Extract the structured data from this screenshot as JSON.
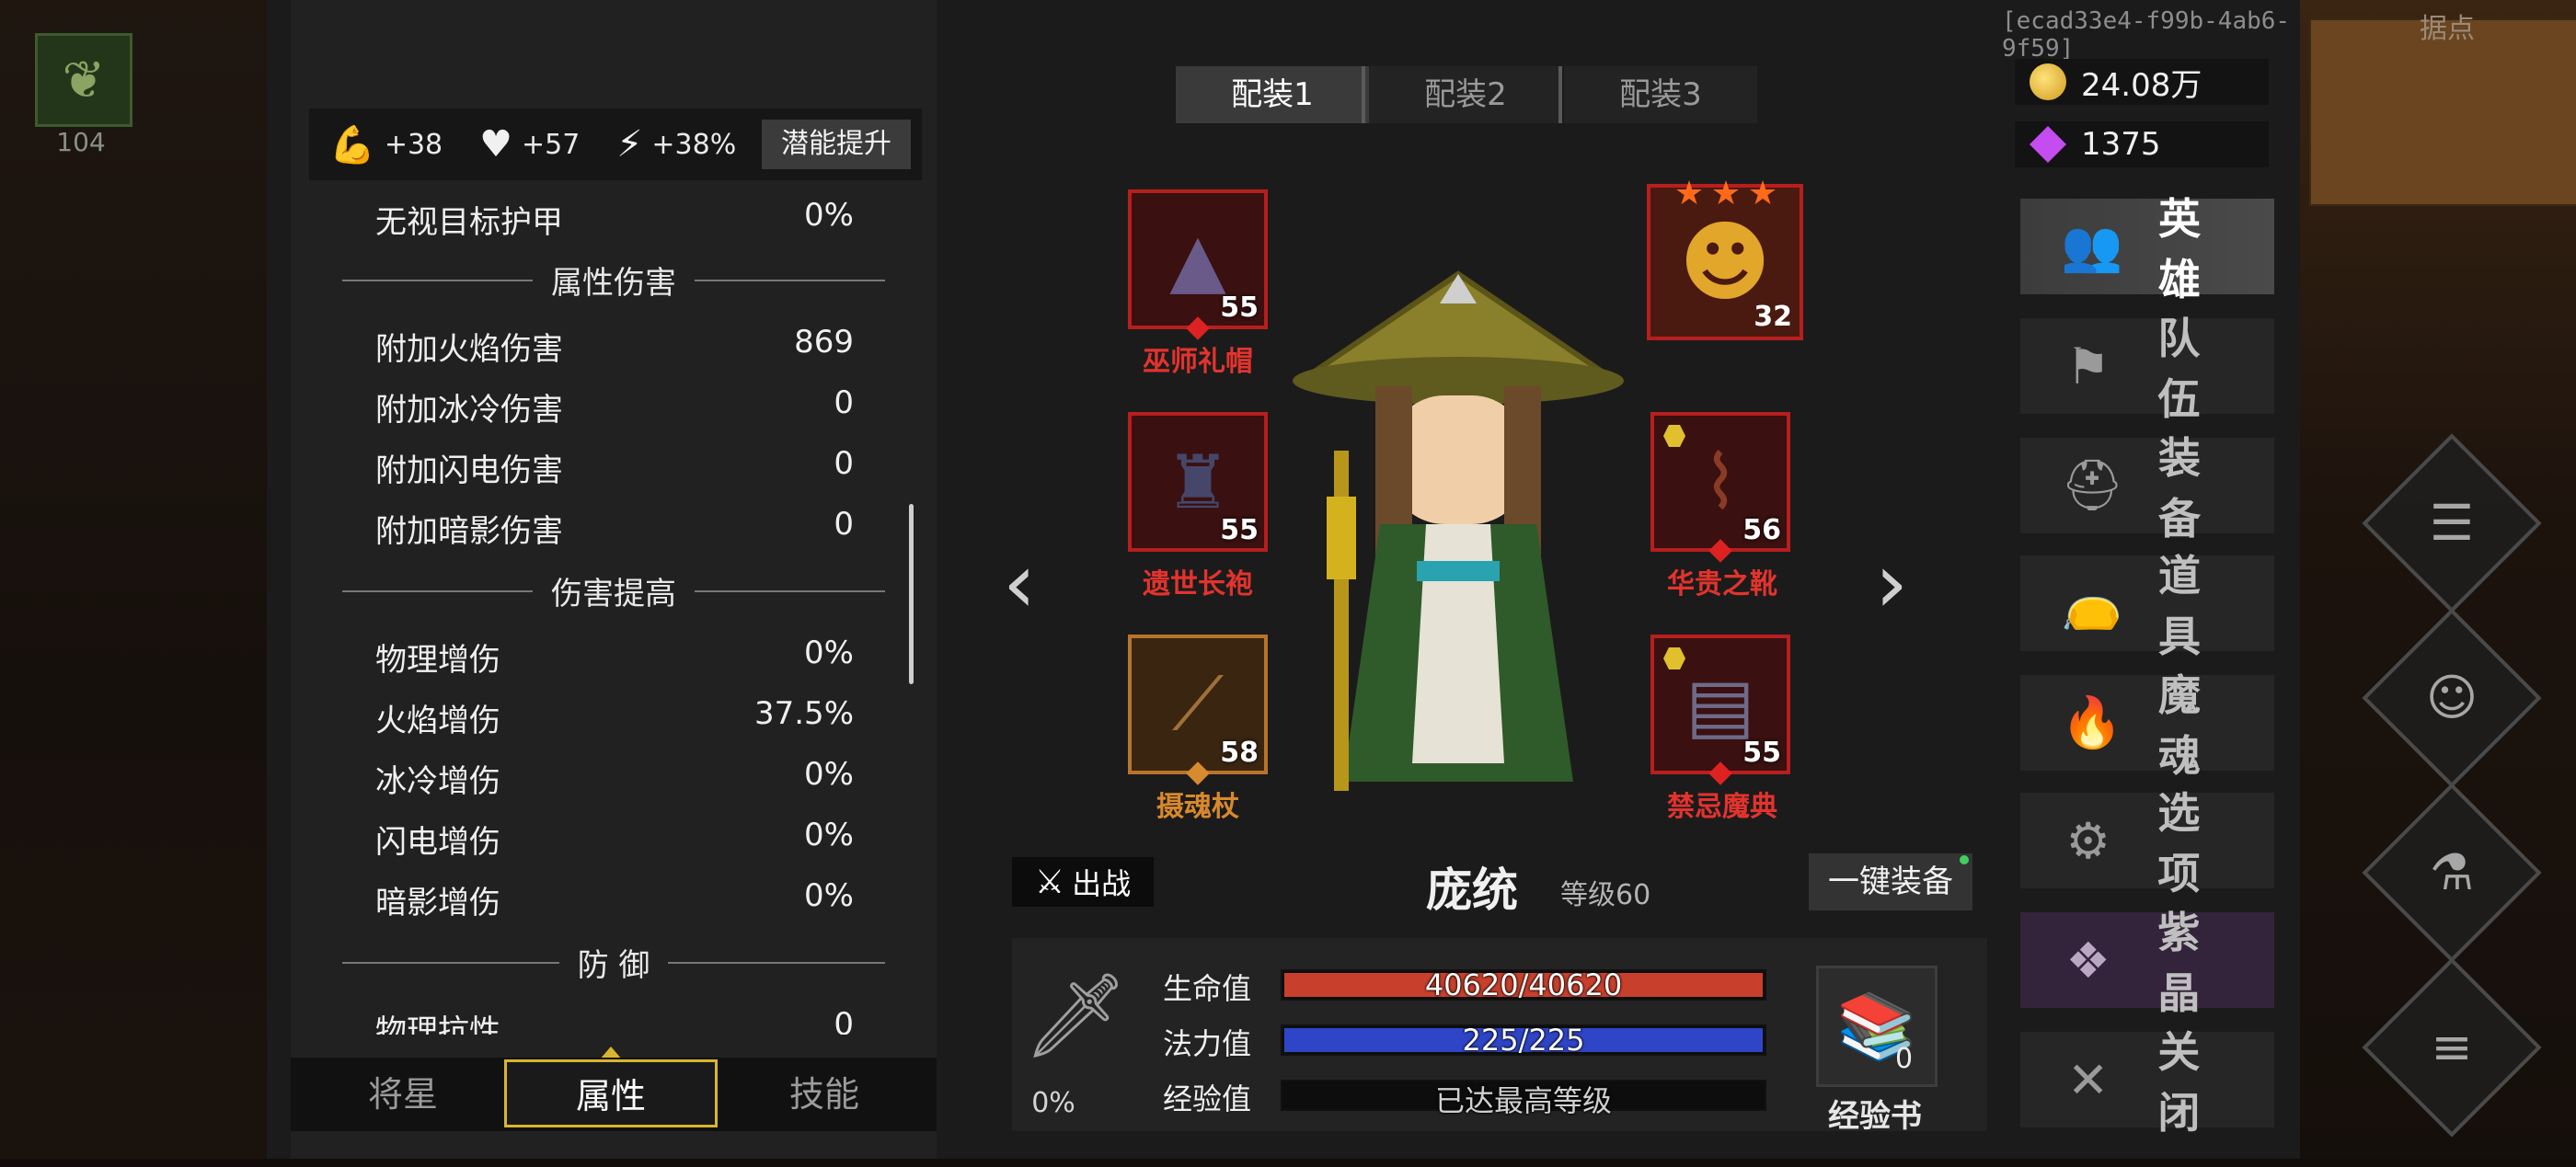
{
  "session_id": "[ecad33e4-f99b-4ab6-9f59]",
  "background": {
    "map_label": "据点",
    "skill_count": "104"
  },
  "stat_bar": {
    "strength": "+38",
    "vitality": "+57",
    "speed": "+38%",
    "potential_button": "潜能提升"
  },
  "attributes": {
    "rows_top": [
      {
        "label": "无视目标护甲",
        "value": "0%"
      }
    ],
    "section_elemental": "属性伤害",
    "elemental": [
      {
        "label": "附加火焰伤害",
        "value": "869"
      },
      {
        "label": "附加冰冷伤害",
        "value": "0"
      },
      {
        "label": "附加闪电伤害",
        "value": "0"
      },
      {
        "label": "附加暗影伤害",
        "value": "0"
      }
    ],
    "section_damage": "伤害提高",
    "damage": [
      {
        "label": "物理增伤",
        "value": "0%"
      },
      {
        "label": "火焰增伤",
        "value": "37.5%"
      },
      {
        "label": "冰冷增伤",
        "value": "0%"
      },
      {
        "label": "闪电增伤",
        "value": "0%"
      },
      {
        "label": "暗影增伤",
        "value": "0%"
      }
    ],
    "section_defense": "防 御",
    "defense": [
      {
        "label": "物理抗性",
        "value": "0"
      }
    ]
  },
  "bottom_tabs": [
    "将星",
    "属性",
    "技能"
  ],
  "loadout_tabs": [
    "配装1",
    "配装2",
    "配装3"
  ],
  "equipment": {
    "hat": {
      "name": "巫师礼帽",
      "level": "55"
    },
    "robe": {
      "name": "遗世长袍",
      "level": "55"
    },
    "staff": {
      "name": "摄魂杖",
      "level": "58"
    },
    "boots": {
      "name": "华贵之靴",
      "level": "56"
    },
    "tome": {
      "name": "禁忌魔典",
      "level": "55"
    },
    "companion": {
      "level": "32",
      "stars": 3
    }
  },
  "hero": {
    "deploy_label": "出战",
    "name": "庞统",
    "level": "等级60",
    "equip_all": "一键装备",
    "hp_label": "生命值",
    "hp_value": "40620/40620",
    "hp_fraction": 1.0,
    "mp_label": "法力值",
    "mp_value": "225/225",
    "mp_fraction": 1.0,
    "exp_label": "经验值",
    "exp_value": "已达最高等级",
    "attack_pct": "0%",
    "exp_book_label": "经验书",
    "exp_book_count": "0"
  },
  "currency": {
    "gold": "24.08万",
    "gems": "1375"
  },
  "menu": [
    {
      "label": "英雄",
      "icon": "hero-icon"
    },
    {
      "label": "队伍",
      "icon": "flag-icon"
    },
    {
      "label": "装备",
      "icon": "helmet-icon"
    },
    {
      "label": "道具",
      "icon": "bag-icon"
    },
    {
      "label": "魔魂",
      "icon": "flame-icon"
    },
    {
      "label": "选项",
      "icon": "gear-icon"
    },
    {
      "label": "紫晶",
      "icon": "crystal-icon"
    },
    {
      "label": "关闭",
      "icon": "close-icon"
    }
  ],
  "colors": {
    "hp": "#c8402c",
    "mp": "#2f45c8",
    "rare_border": "#b81e1e",
    "tab_highlight": "#d8b530"
  }
}
